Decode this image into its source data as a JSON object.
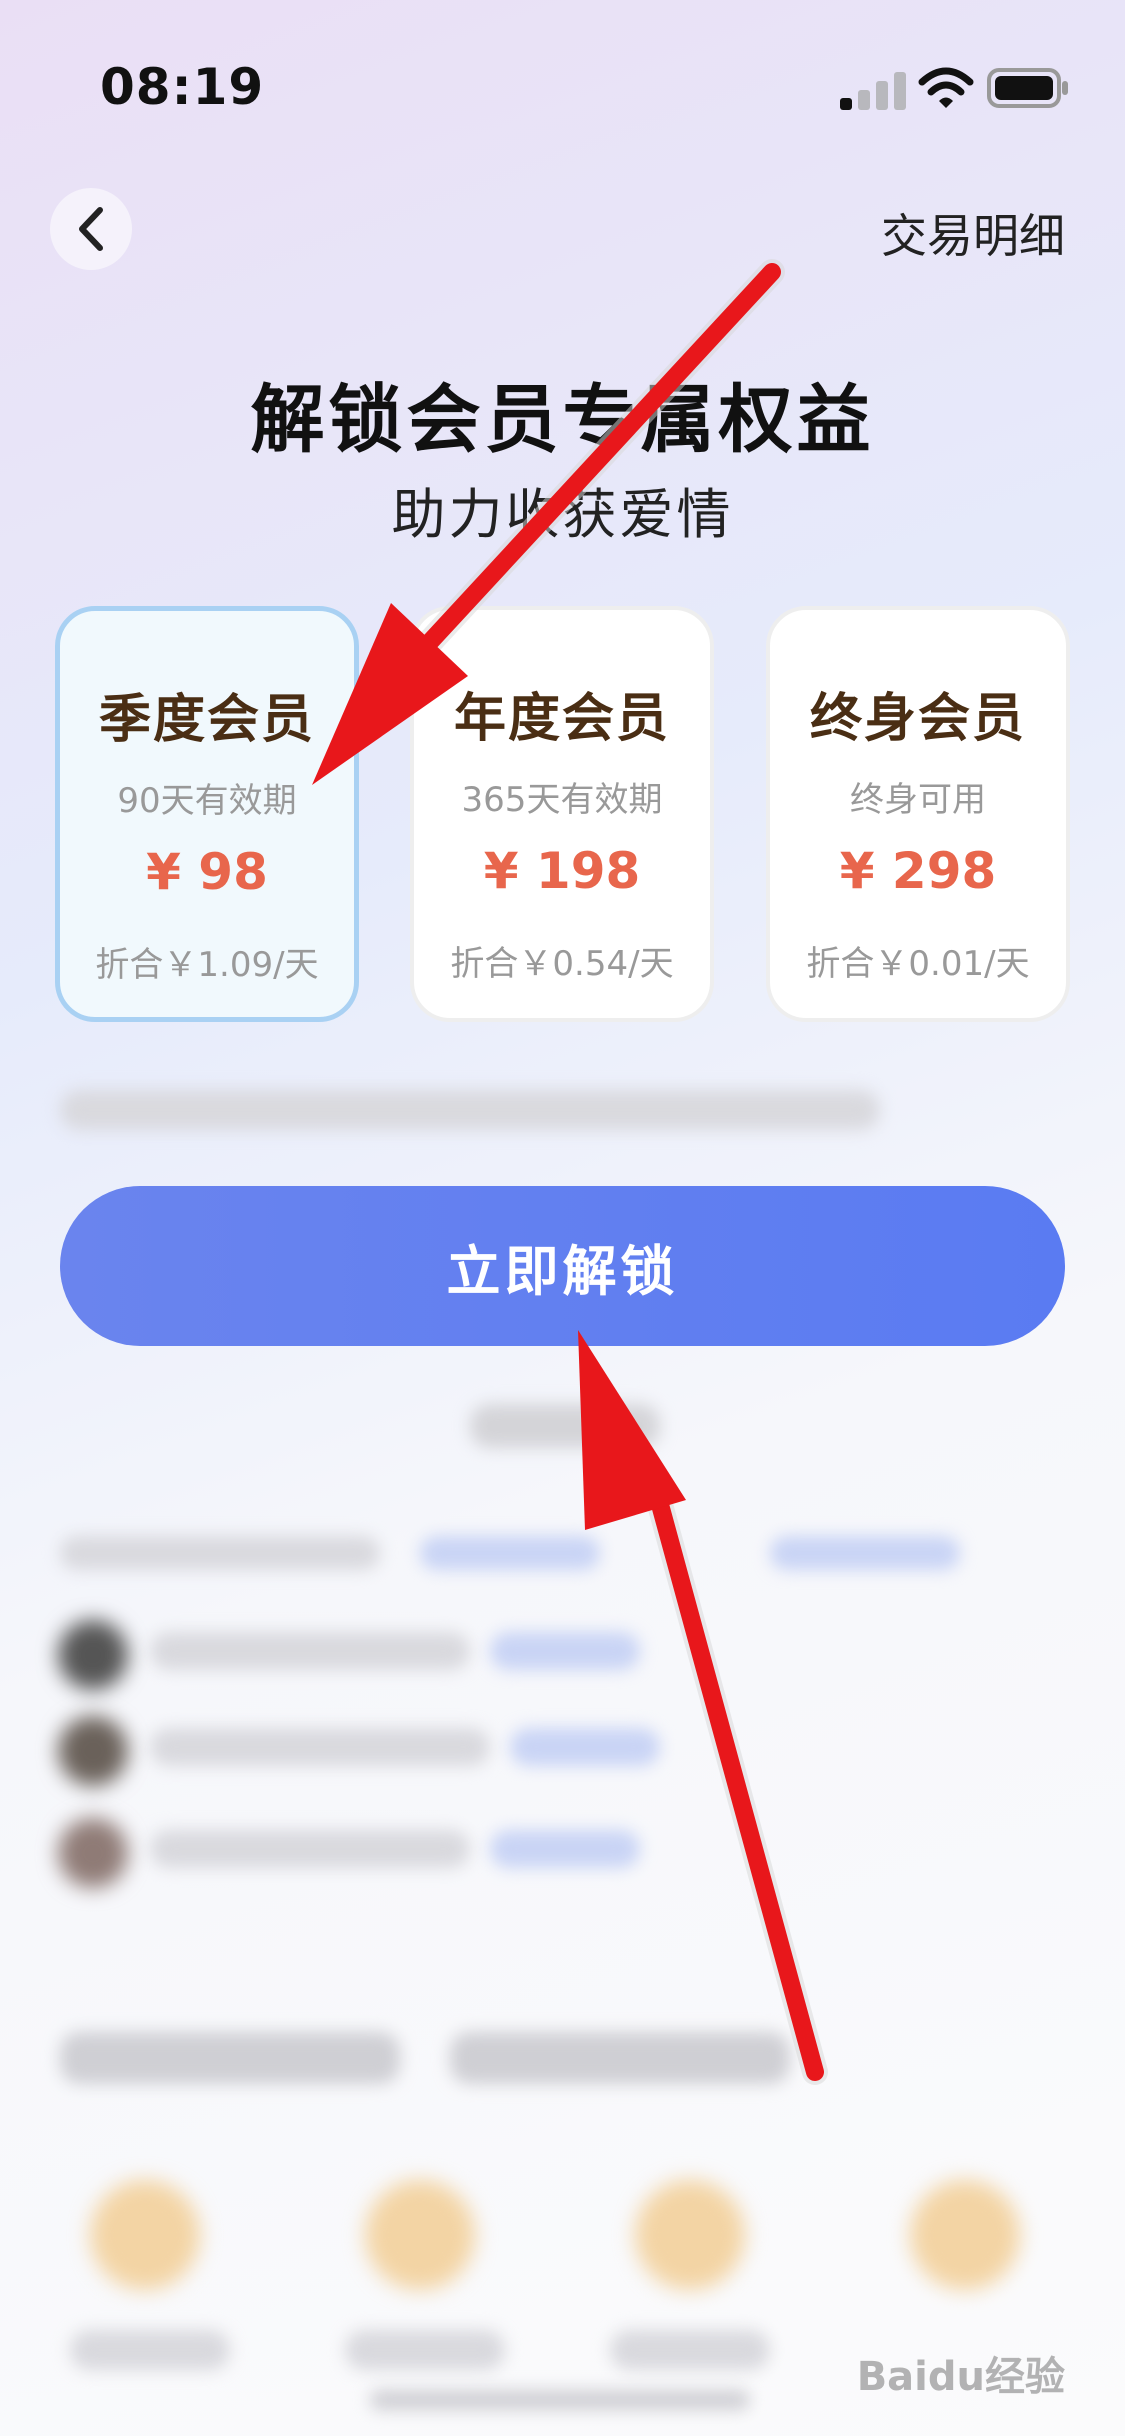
{
  "status_bar": {
    "time": "08:19"
  },
  "header": {
    "transaction_link": "交易明细"
  },
  "title": "解锁会员专属权益",
  "subtitle": "助力收获爱情",
  "plans": [
    {
      "name": "季度会员",
      "validity": "90天有效期",
      "price": "¥ 98",
      "daily": "折合￥1.09/天",
      "selected": true
    },
    {
      "name": "年度会员",
      "validity": "365天有效期",
      "price": "¥ 198",
      "daily": "折合￥0.54/天",
      "selected": false
    },
    {
      "name": "终身会员",
      "validity": "终身可用",
      "price": "¥ 298",
      "daily": "折合￥0.01/天",
      "selected": false
    }
  ],
  "unlock_button": "立即解锁",
  "watermark": "Baidu经验",
  "colors": {
    "accent": "#5a7bf2",
    "price": "#e8664c",
    "plan_name": "#4a2e14",
    "arrow": "#e8171b"
  }
}
